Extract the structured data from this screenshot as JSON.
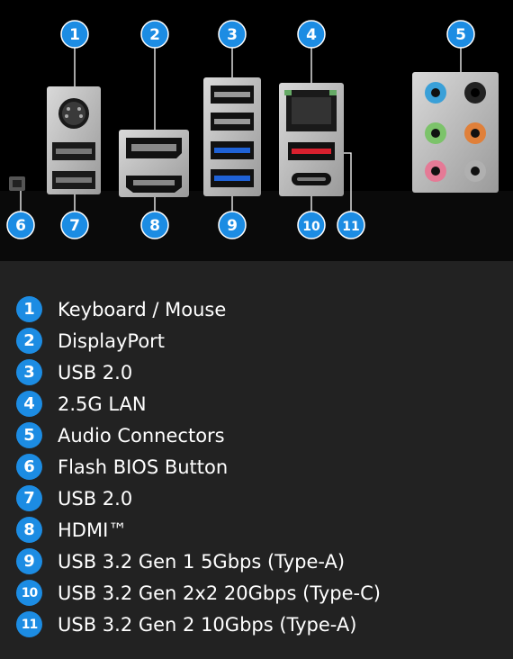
{
  "colors": {
    "badge": "#1c8ce3",
    "panel_background": "#000000",
    "legend_background": "#222222",
    "usb3_blue": "#1f62d6",
    "usb_red": "#d8202e"
  },
  "panel_callouts": [
    "1",
    "2",
    "3",
    "4",
    "5",
    "6",
    "7",
    "8",
    "9",
    "10",
    "11"
  ],
  "legend": [
    {
      "num": "1",
      "label": "Keyboard / Mouse"
    },
    {
      "num": "2",
      "label": "DisplayPort"
    },
    {
      "num": "3",
      "label": "USB 2.0"
    },
    {
      "num": "4",
      "label": "2.5G LAN"
    },
    {
      "num": "5",
      "label": "Audio Connectors"
    },
    {
      "num": "6",
      "label": "Flash BIOS Button"
    },
    {
      "num": "7",
      "label": "USB 2.0"
    },
    {
      "num": "8",
      "label": "HDMI™"
    },
    {
      "num": "9",
      "label": "USB 3.2 Gen 1 5Gbps (Type-A)"
    },
    {
      "num": "10",
      "label": "USB 3.2 Gen 2x2 20Gbps (Type-C)"
    },
    {
      "num": "11",
      "label": "USB 3.2 Gen 2 10Gbps (Type-A)"
    }
  ]
}
